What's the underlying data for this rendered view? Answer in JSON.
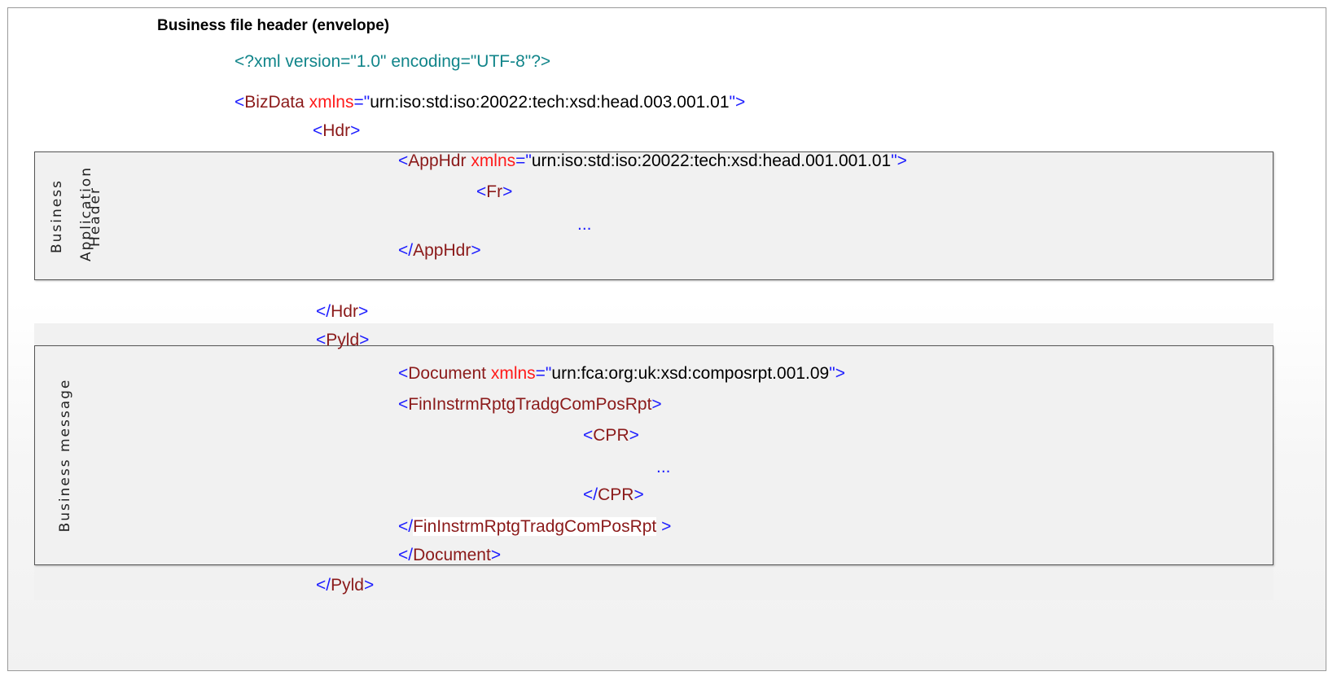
{
  "title": "Business file header (envelope)",
  "labels": {
    "bah_line1": "Business",
    "bah_line2": "Application",
    "bah_line3": "Header",
    "message": "Business message"
  },
  "xml": {
    "decl": "<?xml version=\"1.0\" encoding=\"UTF-8\"?>",
    "bizdata_lt": "<",
    "bizdata_name": "BizData",
    "bizdata_attr": "xmlns",
    "bizdata_eq": "=\"",
    "bizdata_val": "urn:iso:std:iso:20022:tech:xsd:head.003.001.01",
    "bizdata_close": "\">",
    "hdr_lt": "<",
    "hdr_name": "Hdr",
    "hdr_gt": ">",
    "apphdr_lt": "<",
    "apphdr_name": "AppHdr",
    "apphdr_attr": "xmlns",
    "apphdr_eq": "=\"",
    "apphdr_val": "urn:iso:std:iso:20022:tech:xsd:head.001.001.01",
    "apphdr_close": "\">",
    "fr_lt": "<",
    "fr_name": "Fr",
    "fr_gt": ">",
    "ellipsis1": "...",
    "apphdr_end_lt": "</",
    "apphdr_end_name": "AppHdr",
    "apphdr_end_gt": ">",
    "hdr_end_lt": "</",
    "hdr_end_name": "Hdr",
    "hdr_end_gt": ">",
    "pyld_lt": "<",
    "pyld_name": "Pyld",
    "pyld_gt": ">",
    "doc_lt": "<",
    "doc_name": "Document",
    "doc_attr": "xmlns",
    "doc_eq": "=\"",
    "doc_val": "urn:fca:org:uk:xsd:composrpt.001.09",
    "doc_close": "\">",
    "fin_lt": "<",
    "fin_name": "FinInstrmRptgTradgComPosRpt",
    "fin_gt": ">",
    "cpr_lt": "<",
    "cpr_name": "CPR",
    "cpr_gt": ">",
    "ellipsis2": "...",
    "cpr_end_lt": "</",
    "cpr_end_name": "CPR",
    "cpr_end_gt": ">",
    "fin_end_lt": "</",
    "fin_end_name": "FinInstrmRptgTradgComPosRpt",
    "fin_end_gt": " >",
    "doc_end_lt": "</",
    "doc_end_name": "Document",
    "doc_end_gt": ">",
    "pyld_end_lt": "</",
    "pyld_end_name": "Pyld",
    "pyld_end_gt": ">"
  },
  "colors": {
    "bracket": "#1c1cff",
    "element": "#8b1a1a",
    "attribute": "#ff1a1a",
    "declaration": "#11858a",
    "box_fill": "#f1f1f1"
  }
}
